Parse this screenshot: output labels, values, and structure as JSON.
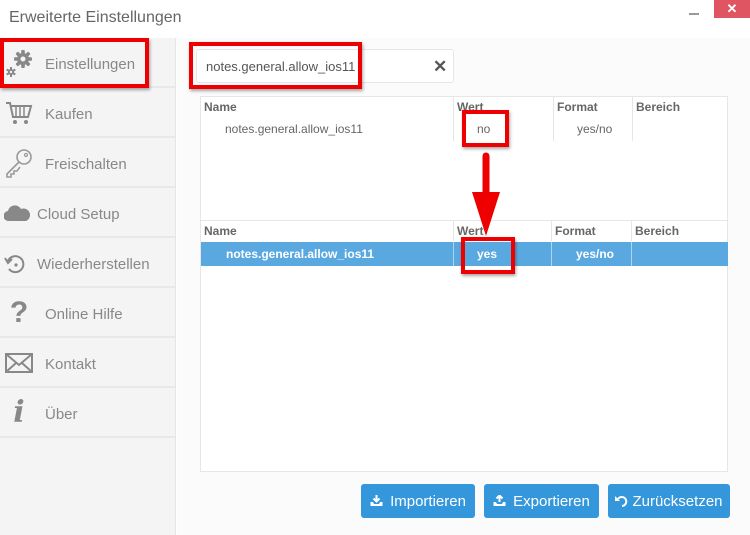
{
  "window": {
    "title": "Erweiterte Einstellungen",
    "minimize_icon": "minimize-icon",
    "close_icon": "close-icon",
    "close_glyph": "✕"
  },
  "sidebar": {
    "items": [
      {
        "label": "Einstellungen",
        "icon": "gears-icon"
      },
      {
        "label": "Kaufen",
        "icon": "cart-icon"
      },
      {
        "label": "Freischalten",
        "icon": "key-icon"
      },
      {
        "label": "Cloud Setup",
        "icon": "cloud-icon"
      },
      {
        "label": "Wiederherstellen",
        "icon": "restore-icon"
      },
      {
        "label": "Online Hilfe",
        "icon": "question-icon"
      },
      {
        "label": "Kontakt",
        "icon": "envelope-icon"
      },
      {
        "label": "Über",
        "icon": "info-icon"
      }
    ]
  },
  "search": {
    "value": "notes.general.allow_ios11",
    "clear_glyph": "✕"
  },
  "table_before": {
    "columns": [
      "Name",
      "Wert",
      "Format",
      "Bereich"
    ],
    "rows": [
      {
        "name": "notes.general.allow_ios11",
        "value": "no",
        "format": "yes/no",
        "range": ""
      }
    ]
  },
  "table_after": {
    "columns": [
      "Name",
      "Wert",
      "Format",
      "Bereich"
    ],
    "rows": [
      {
        "name": "notes.general.allow_ios11",
        "value": "yes",
        "format": "yes/no",
        "range": "",
        "selected": true
      }
    ]
  },
  "buttons": {
    "import": "Importieren",
    "export": "Exportieren",
    "reset": "Zurücksetzen"
  },
  "annotation_color": "#ee0000",
  "accent_color": "#3497dc",
  "selection_color": "#5aa8e0"
}
